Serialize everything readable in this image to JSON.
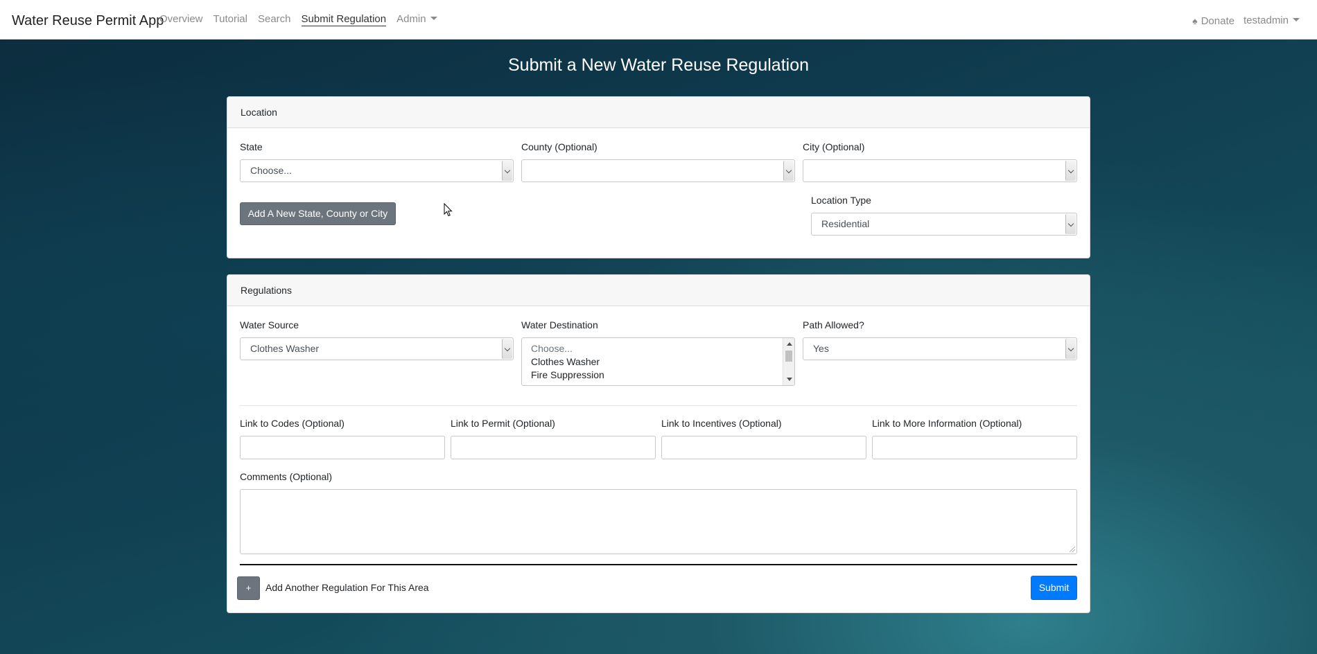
{
  "navbar": {
    "brand": "Water Reuse Permit App",
    "links": [
      "Overview",
      "Tutorial",
      "Search",
      "Submit Regulation",
      "Admin"
    ],
    "donate": "Donate",
    "user": "testadmin"
  },
  "page": {
    "title": "Submit a New Water Reuse Regulation"
  },
  "location": {
    "header": "Location",
    "state_label": "State",
    "state_value": "Choose...",
    "county_label": "County (Optional)",
    "county_value": "",
    "city_label": "City (Optional)",
    "city_value": "",
    "add_button": "Add A New State, County or City",
    "location_type_label": "Location Type",
    "location_type_value": "Residential"
  },
  "regulations": {
    "header": "Regulations",
    "water_source_label": "Water Source",
    "water_source_value": "Clothes Washer",
    "water_destination_label": "Water Destination",
    "water_destination_options": [
      "Choose...",
      "Clothes Washer",
      "Fire Suppression"
    ],
    "path_allowed_label": "Path Allowed?",
    "path_allowed_value": "Yes",
    "link_codes_label": "Link to Codes (Optional)",
    "link_permit_label": "Link to Permit (Optional)",
    "link_incentives_label": "Link to Incentives (Optional)",
    "link_more_label": "Link to More Information (Optional)",
    "comments_label": "Comments (Optional)",
    "add_another_button": "+",
    "add_another_label": "Add Another Regulation For This Area",
    "submit_button": "Submit"
  }
}
